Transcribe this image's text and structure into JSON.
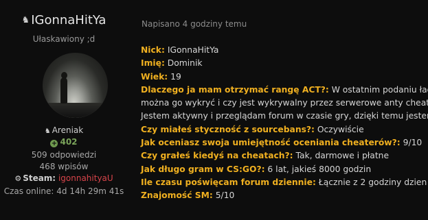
{
  "profile": {
    "username": "IGonnaHitYa",
    "rank_title": "Ułaskawiony ;d",
    "group": "Areniak",
    "reputation": "402",
    "posts_replies": "509 odpowiedzi",
    "posts_count": "468 wpisów",
    "steam_label": "Steam:",
    "steam_id": "igonnahityaU",
    "online_time": "Czas online: 4d 14h 29m 41s"
  },
  "post": {
    "posted": "Napisano 4 godziny temu",
    "lines": [
      {
        "q": "Nick:",
        "a": " IGonnaHitYa"
      },
      {
        "q": "Imię:",
        "a": " Dominik"
      },
      {
        "q": "Wiek:",
        "a": " 19"
      },
      {
        "q": "Dlaczego ja mam otrzymać rangę ACT?:",
        "a": " W ostatnim podaniu ład"
      },
      {
        "q": "",
        "a": "można go wykryć i czy jest wykrywalny przez serwerowe anty cheaty"
      },
      {
        "q": "",
        "a": "Jestem aktywny i przeglądam forum w czasie gry, dzięki temu jestem"
      },
      {
        "q": "Czy miałeś styczność z sourcebans?:",
        "a": " Oczywiście"
      },
      {
        "q": "Jak oceniasz swoja umiejętność oceniania cheaterów?:",
        "a": " 9/10"
      },
      {
        "q": "Czy grałeś kiedyś na cheatach?:",
        "a": " Tak, darmowe i płatne"
      },
      {
        "q": "Jak długo gram w CS:GO?:",
        "a": " 6 lat, jakieś 8000 godzin"
      },
      {
        "q": "Ile czasu poświęcam forum dziennie:",
        "a": " Łącznie z 2 godziny dzien"
      },
      {
        "q": "Znajomość SM:",
        "a": " 5/10"
      }
    ]
  }
}
